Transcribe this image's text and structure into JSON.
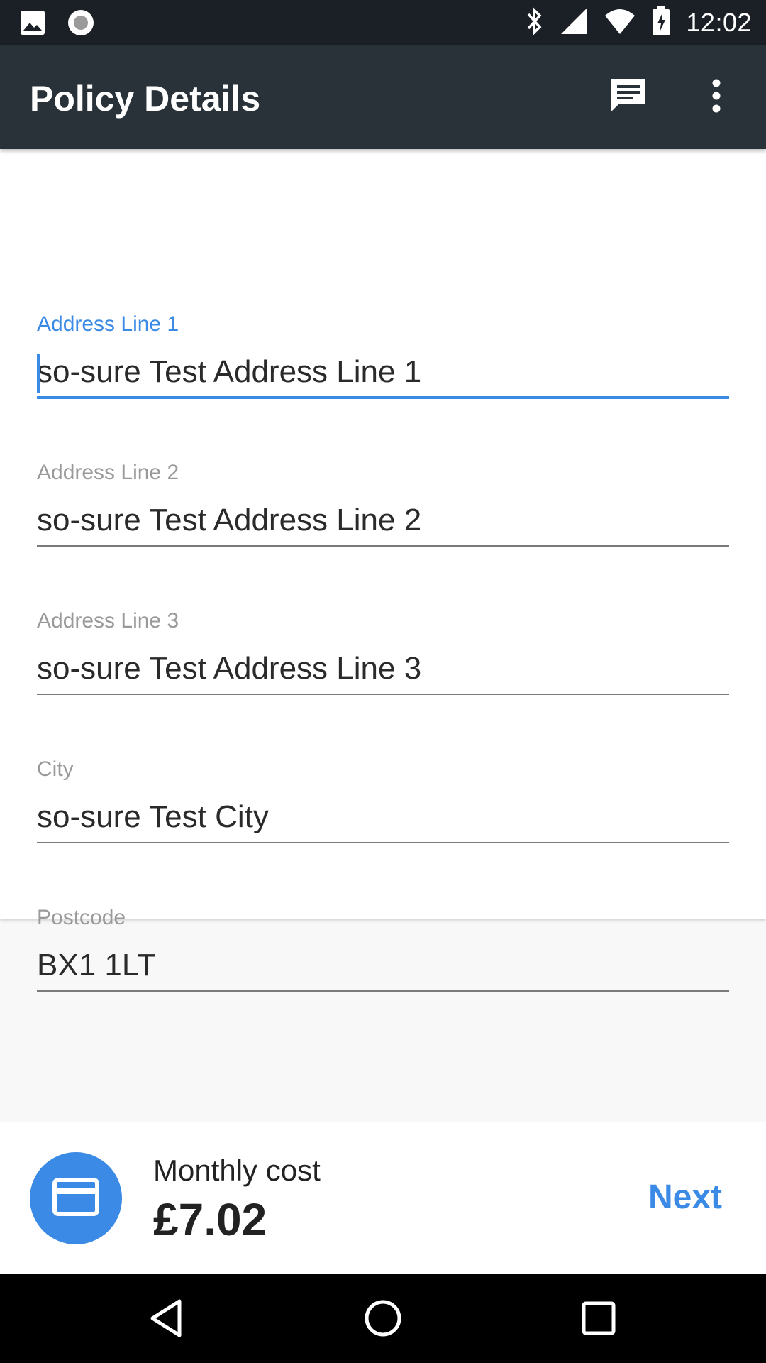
{
  "status_bar": {
    "time": "12:02",
    "left_icons": [
      "image-icon",
      "record-icon"
    ],
    "right_icons": [
      "bluetooth-icon",
      "signal-icon",
      "wifi-icon",
      "battery-charging-icon"
    ]
  },
  "app_bar": {
    "title": "Policy Details",
    "actions": [
      "chat-icon",
      "more-vert-icon"
    ]
  },
  "form": {
    "fields": [
      {
        "label": "Address Line 1",
        "value": "so-sure Test Address Line 1",
        "focused": true
      },
      {
        "label": "Address Line 2",
        "value": "so-sure Test Address Line 2",
        "focused": false
      },
      {
        "label": "Address Line 3",
        "value": "so-sure Test Address Line 3",
        "focused": false
      },
      {
        "label": "City",
        "value": "so-sure Test City",
        "focused": false
      },
      {
        "label": "Postcode",
        "value": "BX1 1LT",
        "focused": false
      }
    ]
  },
  "footer": {
    "cost_label": "Monthly cost",
    "cost_value": "£7.02",
    "next_label": "Next"
  },
  "colors": {
    "accent": "#3b8be6",
    "app_bar": "#293238",
    "status_bar": "#1a2025"
  }
}
